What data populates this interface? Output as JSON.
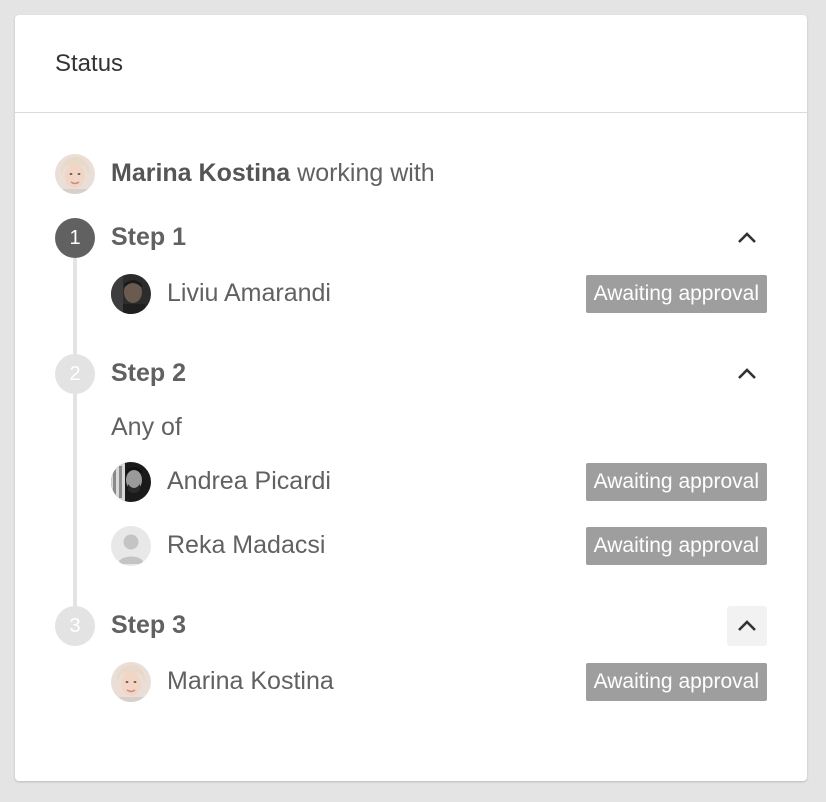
{
  "card": {
    "title": "Status"
  },
  "initiator": {
    "name": "Marina Kostina",
    "suffix": " working with"
  },
  "steps": [
    {
      "number": "1",
      "label": "Step 1",
      "qualifier": "",
      "approvers": [
        {
          "name": "Liviu Amarandi",
          "status": "Awaiting approval"
        }
      ]
    },
    {
      "number": "2",
      "label": "Step 2",
      "qualifier": "Any of",
      "approvers": [
        {
          "name": "Andrea Picardi",
          "status": "Awaiting approval"
        },
        {
          "name": "Reka Madacsi",
          "status": "Awaiting approval"
        }
      ]
    },
    {
      "number": "3",
      "label": "Step 3",
      "qualifier": "",
      "approvers": [
        {
          "name": "Marina Kostina",
          "status": "Awaiting approval"
        }
      ]
    }
  ],
  "icons": {
    "collapse": "chevron-up-icon",
    "avatar_placeholder": "user-placeholder-icon"
  },
  "colors": {
    "active_step": "#616161",
    "inactive_step": "#e3e3e3",
    "badge_bg": "#9e9e9e",
    "badge_text": "#ffffff"
  }
}
